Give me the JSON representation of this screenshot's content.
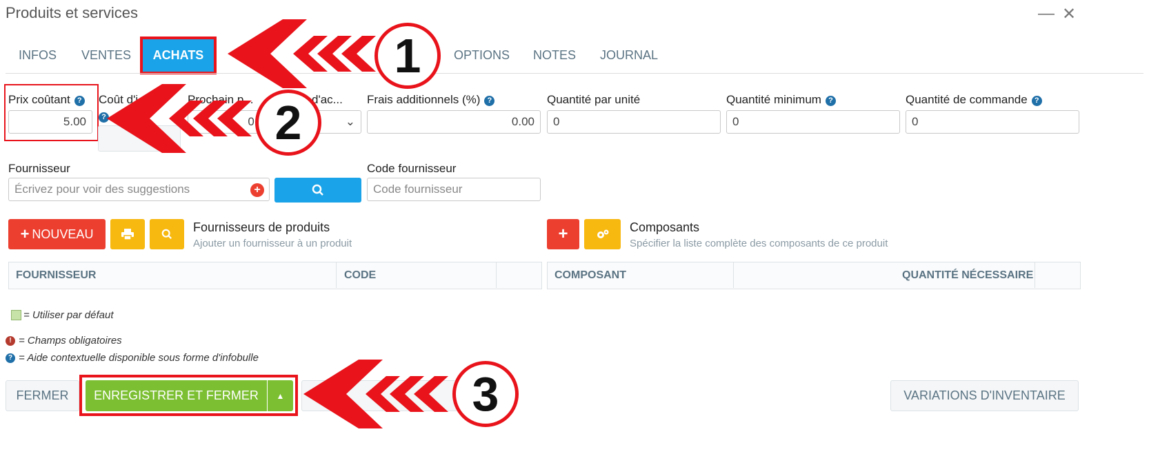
{
  "window": {
    "title": "Produits et services",
    "minimize": "—",
    "close": "✕"
  },
  "tabs": [
    {
      "label": "INFOS"
    },
    {
      "label": "VENTES"
    },
    {
      "label": "ACHATS"
    },
    {
      "label": "OPTIONS"
    },
    {
      "label": "NOTES"
    },
    {
      "label": "JOURNAL"
    }
  ],
  "fields": {
    "prix_coutant": {
      "label": "Prix coûtant",
      "value": "5.00"
    },
    "cout": {
      "label": "Coût d'i..."
    },
    "prochain": {
      "label": "Prochain p...",
      "value": "0.0"
    },
    "acheteur": {
      "label": "d'ac..."
    },
    "frais": {
      "label": "Frais additionnels (%)",
      "value": "0.00"
    },
    "qte_unite": {
      "label": "Quantité par unité",
      "value": "0"
    },
    "qte_min": {
      "label": "Quantité minimum",
      "value": "0"
    },
    "qte_cmd": {
      "label": "Quantité de commande",
      "value": "0"
    }
  },
  "fournisseur": {
    "label": "Fournisseur",
    "placeholder": "Écrivez pour voir des suggestions"
  },
  "code_fournisseur": {
    "label": "Code fournisseur",
    "placeholder": "Code fournisseur"
  },
  "fournisseurs_section": {
    "new_button": "NOUVEAU",
    "title": "Fournisseurs de produits",
    "subtitle": "Ajouter un fournisseur à un produit",
    "columns": [
      "FOURNISSEUR",
      "CODE"
    ]
  },
  "composants_section": {
    "title": "Composants",
    "subtitle": "Spécifier la liste complète des composants de ce produit",
    "columns": [
      "COMPOSANT",
      "QUANTITÉ NÉCESSAIRE"
    ]
  },
  "legend": {
    "default": "= Utiliser par défaut",
    "required": "= Champs obligatoires",
    "help": "= Aide contextuelle disponible sous forme d'infobulle"
  },
  "footer": {
    "close": "FERMER",
    "save_close": "ENREGISTRER ET FERMER",
    "variations": "VARIATIONS D'INVENTAIRE"
  },
  "annotations": {
    "one": "1",
    "two": "2",
    "three": "3"
  },
  "colors": {
    "accent_blue": "#1aa3e8",
    "save_green": "#7cbf33",
    "highlight_red": "#e8131b"
  }
}
